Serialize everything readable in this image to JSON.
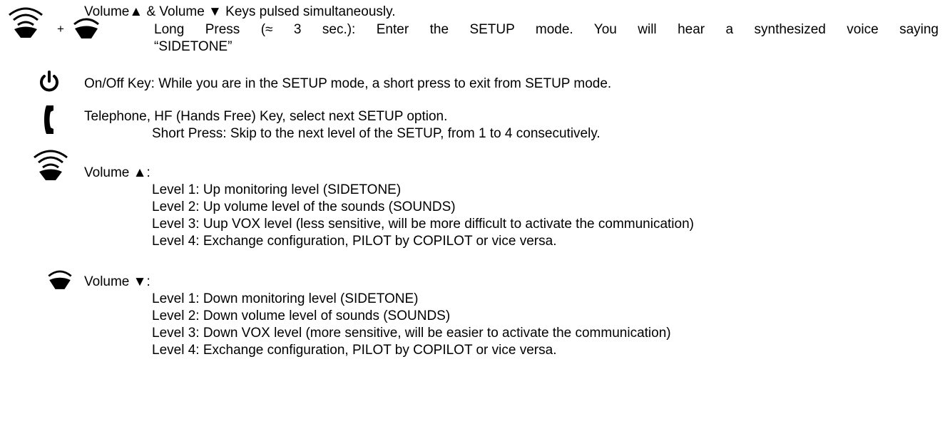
{
  "section_combo": {
    "heading": "Volume▲ & Volume ▼ Keys pulsed simultaneously.",
    "plus": "+",
    "long_press_line1": "Long Press (≈ 3 sec.): Enter the SETUP mode. You will hear a synthesized voice saying",
    "long_press_line2": "“SIDETONE”"
  },
  "section_onoff": {
    "text": "On/Off Key: While you are in the SETUP mode, a short press to exit from SETUP mode."
  },
  "section_phone": {
    "text": "Telephone, HF (Hands Free) Key, select next SETUP option.",
    "short_press": "Short Press: Skip to the next level of the SETUP, from 1 to 4 consecutively."
  },
  "section_volume_up": {
    "heading": "Volume ▲:",
    "levels": [
      "Level 1: Up monitoring level (SIDETONE)",
      "Level 2: Up volume level of the sounds (SOUNDS)",
      "Level 3: Uup VOX level (less sensitive, will be more difficult to activate the communication)",
      "Level 4: Exchange configuration, PILOT by COPILOT or vice versa."
    ]
  },
  "section_volume_down": {
    "heading": "Volume ▼:",
    "levels": [
      "Level 1: Down monitoring level (SIDETONE)",
      "Level 2: Down volume level of sounds (SOUNDS)",
      "Level 3: Down VOX level (more sensitive, will be easier to activate the communication)",
      "Level 4: Exchange configuration, PILOT by COPILOT or vice versa."
    ]
  },
  "colors": {
    "text": "#000000",
    "background": "#ffffff"
  }
}
